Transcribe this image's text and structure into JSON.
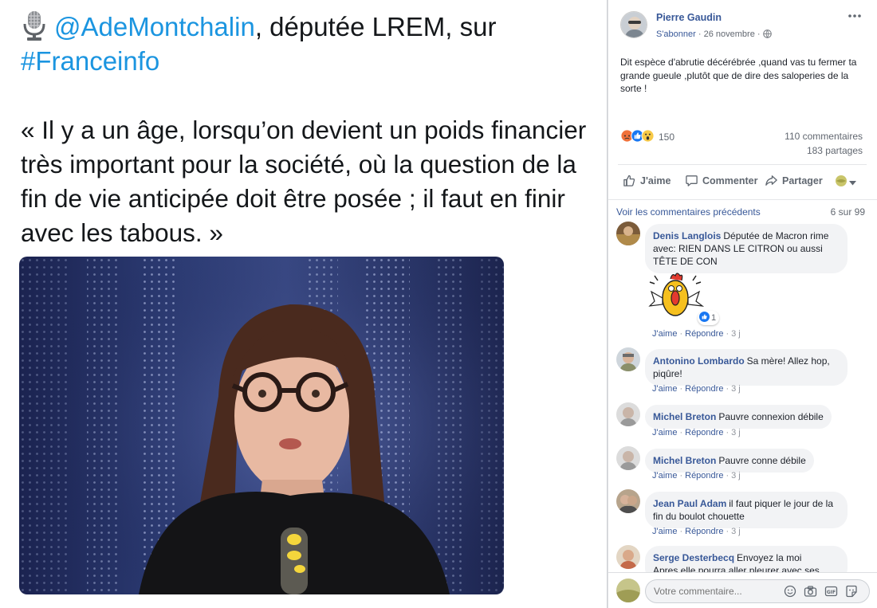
{
  "tweet": {
    "mention": "@AdeMontchalin",
    "head_rest": ", députée LREM, sur",
    "hashtag": "#Franceinfo",
    "quote": "« Il y a un âge, lorsqu’on devient un poids financier très important pour la société, où la question de la fin de vie anticipée doit être posée ; il faut en finir avec les tabous. »"
  },
  "post": {
    "author": "Pierre Gaudin",
    "subscribe": "S'abonner",
    "dot": "·",
    "date": "26 novembre",
    "text": "Dit espèce d'abrutie décérébrée ,quand vas tu fermer ta grande gueule ,plutôt que de dire des saloperies de la sorte !",
    "reactions_count": "150",
    "comments_count": "110 commentaires",
    "shares_count": "183 partages",
    "like_label": "J'aime",
    "comment_label": "Commenter",
    "share_label": "Partager"
  },
  "comments_header": {
    "prev_link": "Voir les commentaires précédents",
    "count": "6 sur 99"
  },
  "comments": [
    {
      "name": "Denis Langlois",
      "text": "Députée de Macron rime avec: RIEN DANS LE CITRON ou aussi TÊTE DE CON",
      "reaction_count": "1"
    },
    {
      "name": "Antonino Lombardo",
      "text": "Sa mère! Allez hop, piqûre!"
    },
    {
      "name": "Michel Breton",
      "text": "Pauvre connexion débile"
    },
    {
      "name": "Michel Breton",
      "text": "Pauvre conne débile"
    },
    {
      "name": "Jean Paul Adam",
      "text": "il faut piquer le jour de la fin du boulot chouette"
    },
    {
      "name": "Serge Desterbecq",
      "text": "Envoyez la moi",
      "text2": "Apres elle pourra aller pleurer avec ses"
    }
  ],
  "comment_actions": {
    "like": "J'aime",
    "reply": "Répondre",
    "sep": "·",
    "time": "3 j"
  },
  "composer": {
    "placeholder": "Votre commentaire..."
  },
  "colors": {
    "link": "#385898",
    "hashtag": "#1b95e0",
    "bubble": "#f2f3f5",
    "like_blue": "#1877f2"
  },
  "icons": [
    "microphone-icon",
    "more-icon",
    "globe-icon",
    "like-icon",
    "comment-icon",
    "share-icon",
    "audience-icon",
    "emoji-icon",
    "camera-icon",
    "gif-icon",
    "sticker-icon"
  ]
}
